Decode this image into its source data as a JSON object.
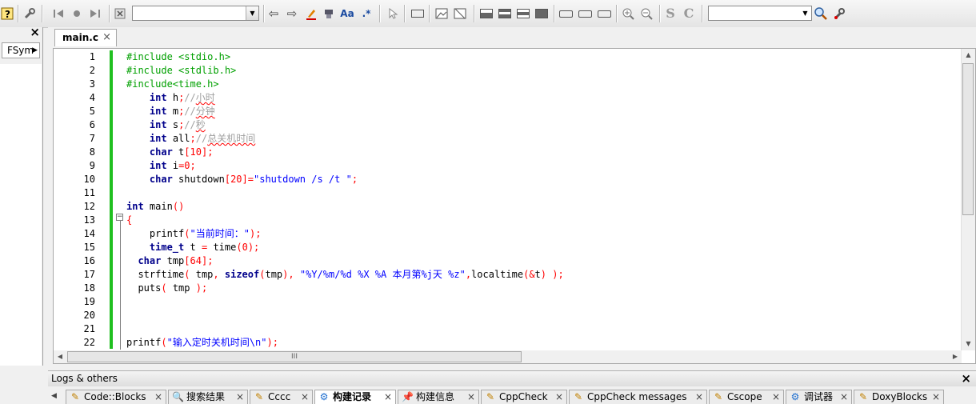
{
  "toolbar": {
    "find_combo_value": "",
    "symbol_combo_value": "",
    "icons": [
      "help-icon",
      "settings-icon",
      "jump-back-icon",
      "toggle-breakpoint-icon",
      "jump-forward-icon",
      "clear-icon",
      "arrow-left-icon",
      "arrow-right-icon",
      "highlight-icon",
      "stamp-icon",
      "match-case-icon",
      "regex-icon",
      "select-icon",
      "rect-icon",
      "image-icon",
      "block-icon",
      "zoom-in-icon",
      "zoom-out-icon",
      "symbol-s-icon",
      "symbol-c-icon",
      "search-icon",
      "wrench-icon"
    ],
    "text_glyphs": {
      "aa": "Aa",
      "regex": ".*",
      "s": "S",
      "c": "C"
    }
  },
  "left_panel": {
    "tab_label": "FSym"
  },
  "editor": {
    "file_tab": "main.c",
    "line_numbers": [
      "1",
      "2",
      "3",
      "4",
      "5",
      "6",
      "7",
      "8",
      "9",
      "10",
      "11",
      "12",
      "13",
      "14",
      "15",
      "16",
      "17",
      "18",
      "19",
      "20",
      "21",
      "22"
    ],
    "scroll_thumb_label": "III",
    "lines": [
      {
        "text": "#include <stdio.h>"
      },
      {
        "text": "#include <stdlib.h>"
      },
      {
        "text": "#include<time.h>"
      },
      {
        "text": "    int h;//小时"
      },
      {
        "text": "    int m;//分钟"
      },
      {
        "text": "    int s;//秒"
      },
      {
        "text": "    int all;//总关机时间"
      },
      {
        "text": "    char t[10];"
      },
      {
        "text": "    int i=0;"
      },
      {
        "text": "    char shutdown[20]=\"shutdown /s /t \";"
      },
      {
        "text": ""
      },
      {
        "text": "int main()"
      },
      {
        "text": "{"
      },
      {
        "text": "    printf(\"当前时间：\");"
      },
      {
        "text": "    time_t t = time(0);"
      },
      {
        "text": "  char tmp[64];"
      },
      {
        "text": "  strftime( tmp, sizeof(tmp), \"%Y/%m/%d %X %A 本月第%j天 %z\",localtime(&t) );"
      },
      {
        "text": "  puts( tmp );"
      },
      {
        "text": ""
      },
      {
        "text": ""
      },
      {
        "text": ""
      },
      {
        "text": "printf(\"输入定时关机时间\\n\");"
      }
    ]
  },
  "logs": {
    "title": "Logs & others",
    "tabs": [
      {
        "label": "Code::Blocks",
        "icon": "note-icon",
        "active": false
      },
      {
        "label": "搜索结果",
        "icon": "search-icon",
        "active": false
      },
      {
        "label": "Cccc",
        "icon": "note-icon",
        "active": false
      },
      {
        "label": "构建记录",
        "icon": "gear-icon",
        "active": true
      },
      {
        "label": "构建信息",
        "icon": "pin-icon",
        "active": false
      },
      {
        "label": "CppCheck",
        "icon": "note-icon",
        "active": false
      },
      {
        "label": "CppCheck messages",
        "icon": "note-icon",
        "active": false
      },
      {
        "label": "Cscope",
        "icon": "note-icon",
        "active": false
      },
      {
        "label": "调试器",
        "icon": "gear-icon",
        "active": false
      },
      {
        "label": "DoxyBlocks",
        "icon": "note-icon",
        "active": false
      }
    ]
  },
  "colors": {
    "preprocessor": "#00a000",
    "keyword": "#00008b",
    "comment": "#a0a0a0",
    "string": "#0000ff",
    "number": "#ff0000",
    "change_bar": "#20c020"
  }
}
